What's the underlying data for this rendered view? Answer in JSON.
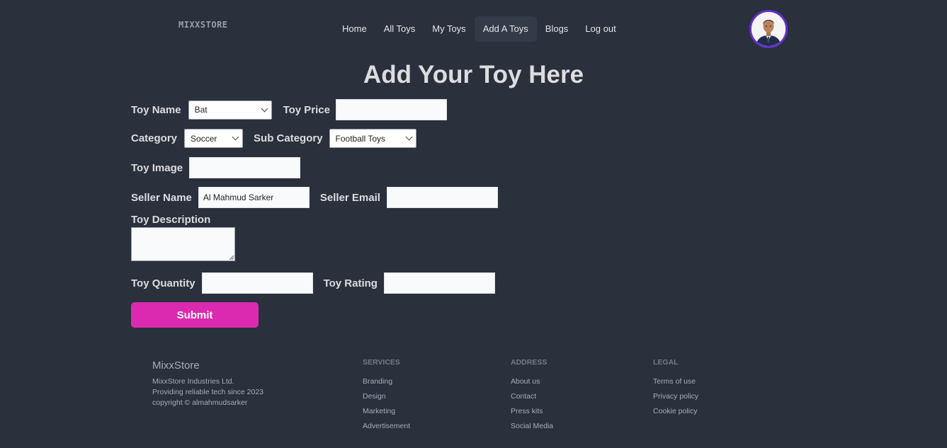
{
  "navbar": {
    "logo": "MIXXSTORE",
    "links": [
      "Home",
      "All Toys",
      "My Toys",
      "Add A Toys",
      "Blogs",
      "Log out"
    ],
    "active_link": "Add A Toys"
  },
  "heading": "Add Your Toy Here",
  "form": {
    "toy_name_label": "Toy Name",
    "toy_name_value": "Bat",
    "toy_price_label": "Toy Price",
    "toy_price_value": "",
    "category_label": "Category",
    "category_value": "Soccer",
    "sub_category_label": "Sub Category",
    "sub_category_value": "Football Toys",
    "toy_image_label": "Toy Image",
    "toy_image_value": "",
    "seller_name_label": "Seller Name",
    "seller_name_value": "Al Mahmud Sarker",
    "seller_email_label": "Seller Email",
    "seller_email_value": "",
    "toy_description_label": "Toy Description",
    "toy_quantity_label": "Toy Quantity",
    "toy_quantity_value": "",
    "toy_rating_label": "Toy Rating",
    "toy_rating_value": "",
    "submit_label": "Submit"
  },
  "footer": {
    "brand": {
      "name": "MixxStore",
      "line1": "MixxStore Industries Ltd.",
      "line2": "Providing reliable tech since 2023",
      "line3": "copyright © almahmudsarker"
    },
    "services": {
      "title": "SERVICES",
      "items": [
        "Branding",
        "Design",
        "Marketing",
        "Advertisement"
      ]
    },
    "address": {
      "title": "ADDRESS",
      "items": [
        "About us",
        "Contact",
        "Press kits",
        "Social Media"
      ]
    },
    "legal": {
      "title": "LEGAL",
      "items": [
        "Terms of use",
        "Privacy policy",
        "Cookie policy"
      ]
    }
  },
  "colors": {
    "background": "#2a303c",
    "accent": "#db2aaf",
    "avatar_ring": "#6431c9"
  },
  "icons": {
    "avatar": "user-avatar-photo",
    "select_arrow": "chevron-down-icon"
  }
}
